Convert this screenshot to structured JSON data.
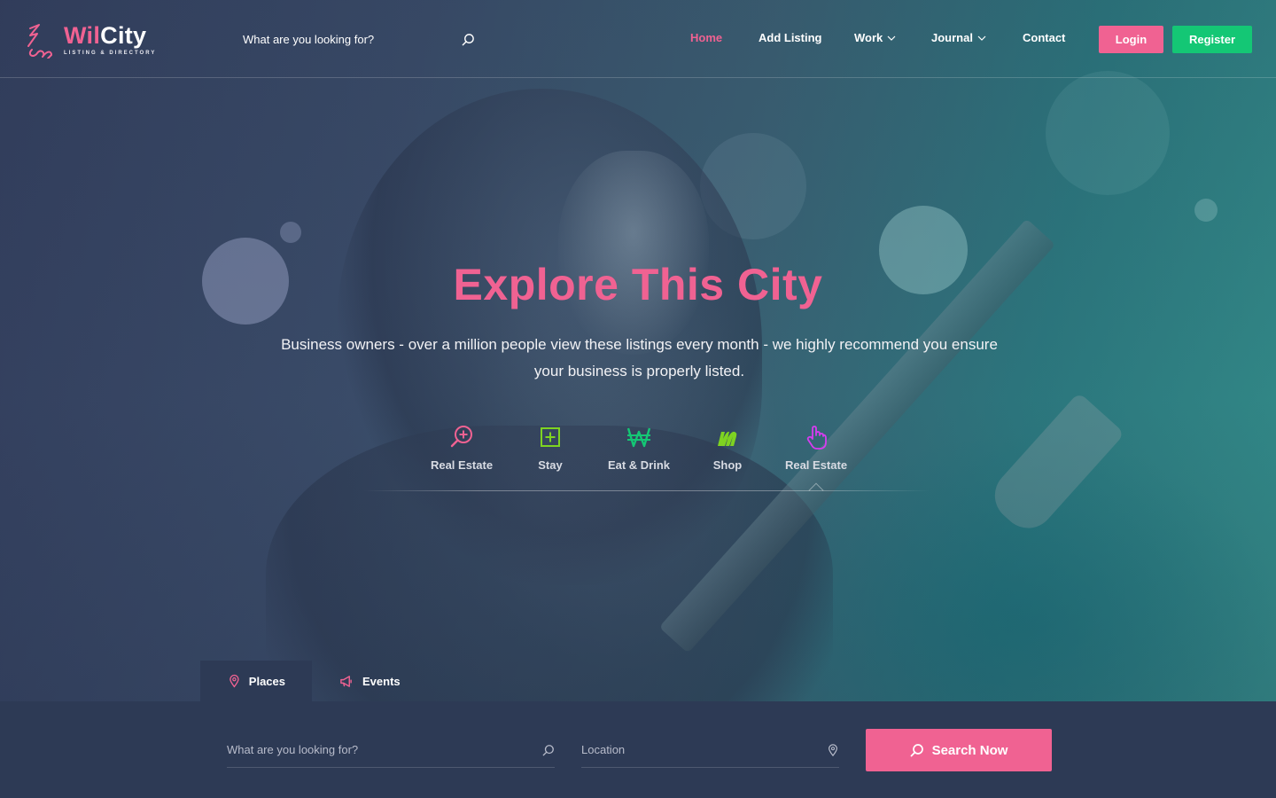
{
  "brand": {
    "name_part1": "Wil",
    "name_part2": "City",
    "tagline": "LISTING & DIRECTORY",
    "accent_color": "#f06292",
    "success_color": "#14c775"
  },
  "header": {
    "search_placeholder": "What are you looking for?",
    "nav": [
      {
        "label": "Home",
        "active": true
      },
      {
        "label": "Add Listing"
      },
      {
        "label": "Work",
        "has_dropdown": true
      },
      {
        "label": "Journal",
        "has_dropdown": true
      },
      {
        "label": "Contact"
      }
    ],
    "login_label": "Login",
    "register_label": "Register"
  },
  "hero": {
    "title": "Explore This City",
    "subtitle": "Business owners - over a million people view these listings every month - we highly recommend you ensure your business is properly listed."
  },
  "categories": [
    {
      "label": "Real Estate",
      "icon": "search-plus-icon",
      "color": "#f06292"
    },
    {
      "label": "Stay",
      "icon": "plus-square-icon",
      "color": "#7ed321"
    },
    {
      "label": "Eat & Drink",
      "icon": "won-sign-icon",
      "color": "#14c775"
    },
    {
      "label": "Shop",
      "icon": "m-letter-icon",
      "color": "#7ed321"
    },
    {
      "label": "Real Estate",
      "icon": "pointer-hand-icon",
      "color": "#d63cf0",
      "selected": true
    }
  ],
  "search_panel": {
    "tabs": [
      {
        "label": "Places",
        "icon": "map-pin-icon",
        "active": true
      },
      {
        "label": "Events",
        "icon": "megaphone-icon"
      }
    ],
    "keyword_placeholder": "What are you looking for?",
    "location_placeholder": "Location",
    "submit_label": "Search Now"
  }
}
